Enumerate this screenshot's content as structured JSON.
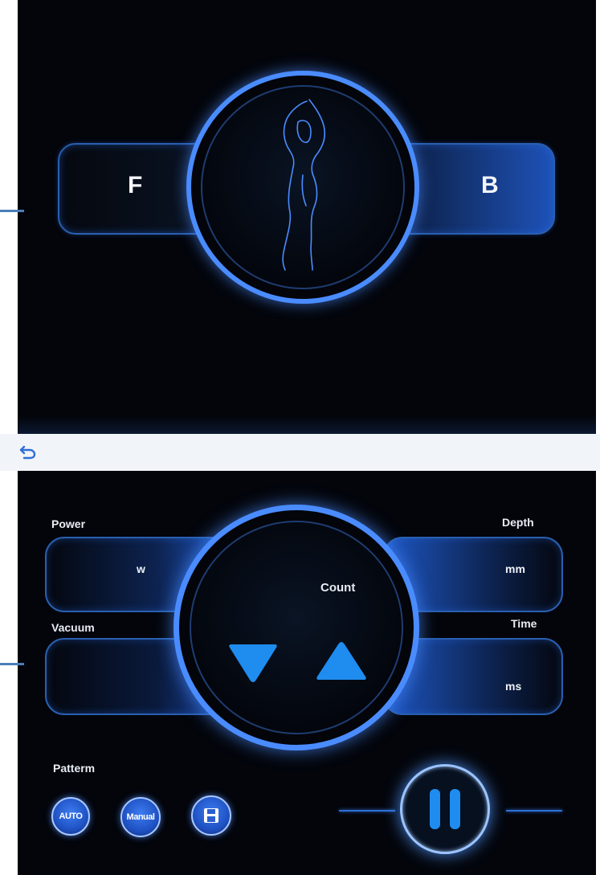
{
  "top": {
    "front_label": "F",
    "back_label": "B"
  },
  "nav": {
    "back_icon": "undo-arrow-icon"
  },
  "params": {
    "power_label": "Power",
    "power_unit": "w",
    "depth_label": "Depth",
    "depth_unit": "mm",
    "vacuum_label": "Vacuum",
    "time_label": "Time",
    "time_unit": "ms",
    "count_label": "Count"
  },
  "pattern": {
    "label": "Patterm",
    "auto_label": "AUTO",
    "manual_label": "Manual",
    "save_icon": "floppy-disk-icon"
  },
  "controls": {
    "decrease_icon": "triangle-down-icon",
    "increase_icon": "triangle-up-icon",
    "pause_icon": "pause-icon"
  },
  "colors": {
    "accent": "#3a7bf0",
    "background": "#03050b",
    "ring": "#4a8cff"
  }
}
